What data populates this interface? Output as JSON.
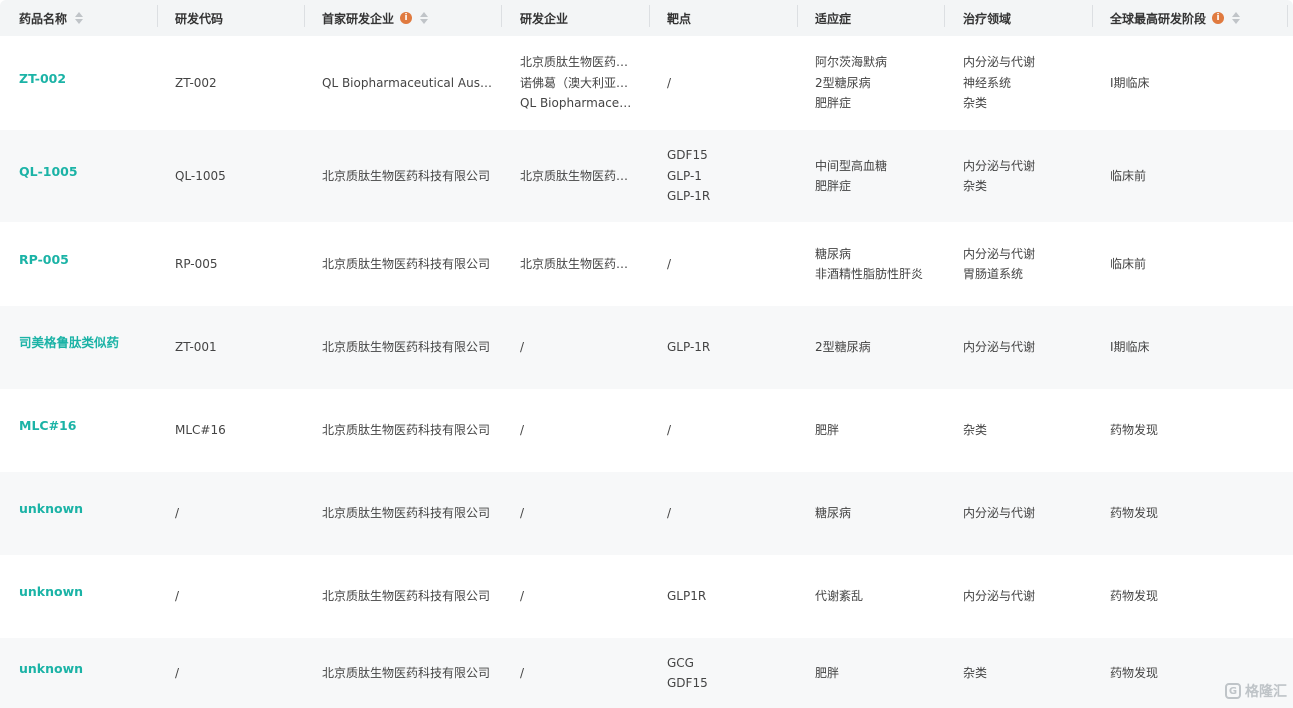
{
  "header": {
    "col_name": "药品名称",
    "col_code": "研发代码",
    "col_first_company": "首家研发企业",
    "col_company": "研发企业",
    "col_target": "靶点",
    "col_indication": "适应症",
    "col_area": "治疗领域",
    "col_phase": "全球最高研发阶段",
    "info_glyph": "i"
  },
  "rows": [
    {
      "name": "ZT-002",
      "code": "ZT-002",
      "first_company": "QL Biopharmaceutical Austr...",
      "company": [
        "北京质肽生物医药科...",
        "诺佛葛（澳大利亚）...",
        "QL Biopharmaceuti..."
      ],
      "target": [
        "/"
      ],
      "indication": [
        "阿尔茨海默病",
        "2型糖尿病",
        "肥胖症"
      ],
      "area": [
        "内分泌与代谢",
        "神经系统",
        "杂类"
      ],
      "phase": "Ⅰ期临床"
    },
    {
      "name": "QL-1005",
      "code": "QL-1005",
      "first_company": "北京质肽生物医药科技有限公司",
      "company": [
        "北京质肽生物医药科..."
      ],
      "target": [
        "GDF15",
        "GLP-1",
        "GLP-1R"
      ],
      "indication": [
        "中间型高血糖",
        "肥胖症"
      ],
      "area": [
        "内分泌与代谢",
        "杂类"
      ],
      "phase": "临床前"
    },
    {
      "name": "RP-005",
      "code": "RP-005",
      "first_company": "北京质肽生物医药科技有限公司",
      "company": [
        "北京质肽生物医药科..."
      ],
      "target": [
        "/"
      ],
      "indication": [
        "糖尿病",
        "非酒精性脂肪性肝炎"
      ],
      "area": [
        "内分泌与代谢",
        "胃肠道系统"
      ],
      "phase": "临床前"
    },
    {
      "name": "司美格鲁肽类似药",
      "code": "ZT-001",
      "first_company": "北京质肽生物医药科技有限公司",
      "company": [
        "/"
      ],
      "target": [
        "GLP-1R"
      ],
      "indication": [
        "2型糖尿病"
      ],
      "area": [
        "内分泌与代谢"
      ],
      "phase": "Ⅰ期临床"
    },
    {
      "name": "MLC#16",
      "code": "MLC#16",
      "first_company": "北京质肽生物医药科技有限公司",
      "company": [
        "/"
      ],
      "target": [
        "/"
      ],
      "indication": [
        "肥胖"
      ],
      "area": [
        "杂类"
      ],
      "phase": "药物发现"
    },
    {
      "name": "unknown",
      "code": "/",
      "first_company": "北京质肽生物医药科技有限公司",
      "company": [
        "/"
      ],
      "target": [
        "/"
      ],
      "indication": [
        "糖尿病"
      ],
      "area": [
        "内分泌与代谢"
      ],
      "phase": "药物发现"
    },
    {
      "name": "unknown",
      "code": "/",
      "first_company": "北京质肽生物医药科技有限公司",
      "company": [
        "/"
      ],
      "target": [
        "GLP1R"
      ],
      "indication": [
        "代谢紊乱"
      ],
      "area": [
        "内分泌与代谢"
      ],
      "phase": "药物发现"
    },
    {
      "name": "unknown",
      "code": "/",
      "first_company": "北京质肽生物医药科技有限公司",
      "company": [
        "/"
      ],
      "target": [
        "GCG",
        "GDF15"
      ],
      "indication": [
        "肥胖"
      ],
      "area": [
        "杂类"
      ],
      "phase": "药物发现"
    }
  ],
  "watermark": {
    "text": "格隆汇",
    "icon": "G"
  }
}
